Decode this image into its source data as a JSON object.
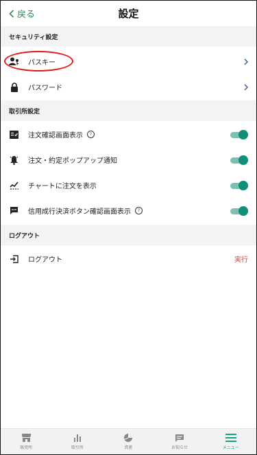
{
  "header": {
    "back_label": "戻る",
    "title": "設定"
  },
  "sections": {
    "security": {
      "title": "セキュリティ設定"
    },
    "exchange": {
      "title": "取引所設定"
    },
    "logout": {
      "title": "ログアウト"
    }
  },
  "security_items": [
    {
      "label": "パスキー",
      "icon": "passkey-user-key-icon"
    },
    {
      "label": "パスワード",
      "icon": "lock-icon"
    }
  ],
  "exchange_items": [
    {
      "label": "注文確認画面表示",
      "help": "?",
      "icon": "order-confirm-icon",
      "enabled": true
    },
    {
      "label": "注文・約定ポップアップ通知",
      "icon": "bell-icon",
      "enabled": true
    },
    {
      "label": "チャートに注文を表示",
      "icon": "chart-pen-icon",
      "enabled": true
    },
    {
      "label": "信用成行決済ボタン確認画面表示",
      "help": "?",
      "icon": "message-icon",
      "enabled": true
    }
  ],
  "logout_item": {
    "label": "ログアウト",
    "action": "実行",
    "icon": "logout-icon"
  },
  "bottom_nav": [
    {
      "label": "販売所",
      "icon": "store-icon",
      "active": false
    },
    {
      "label": "取引所",
      "icon": "bar-chart-icon",
      "active": false
    },
    {
      "label": "資産",
      "icon": "pie-chart-icon",
      "active": false
    },
    {
      "label": "お知らせ",
      "icon": "message-icon",
      "active": false
    },
    {
      "label": "メニュー",
      "icon": "menu-icon",
      "active": true
    }
  ],
  "colors": {
    "accent": "#0f8f7a",
    "back": "#2e8b57",
    "danger": "#d0463c",
    "highlight": "#e01818"
  }
}
